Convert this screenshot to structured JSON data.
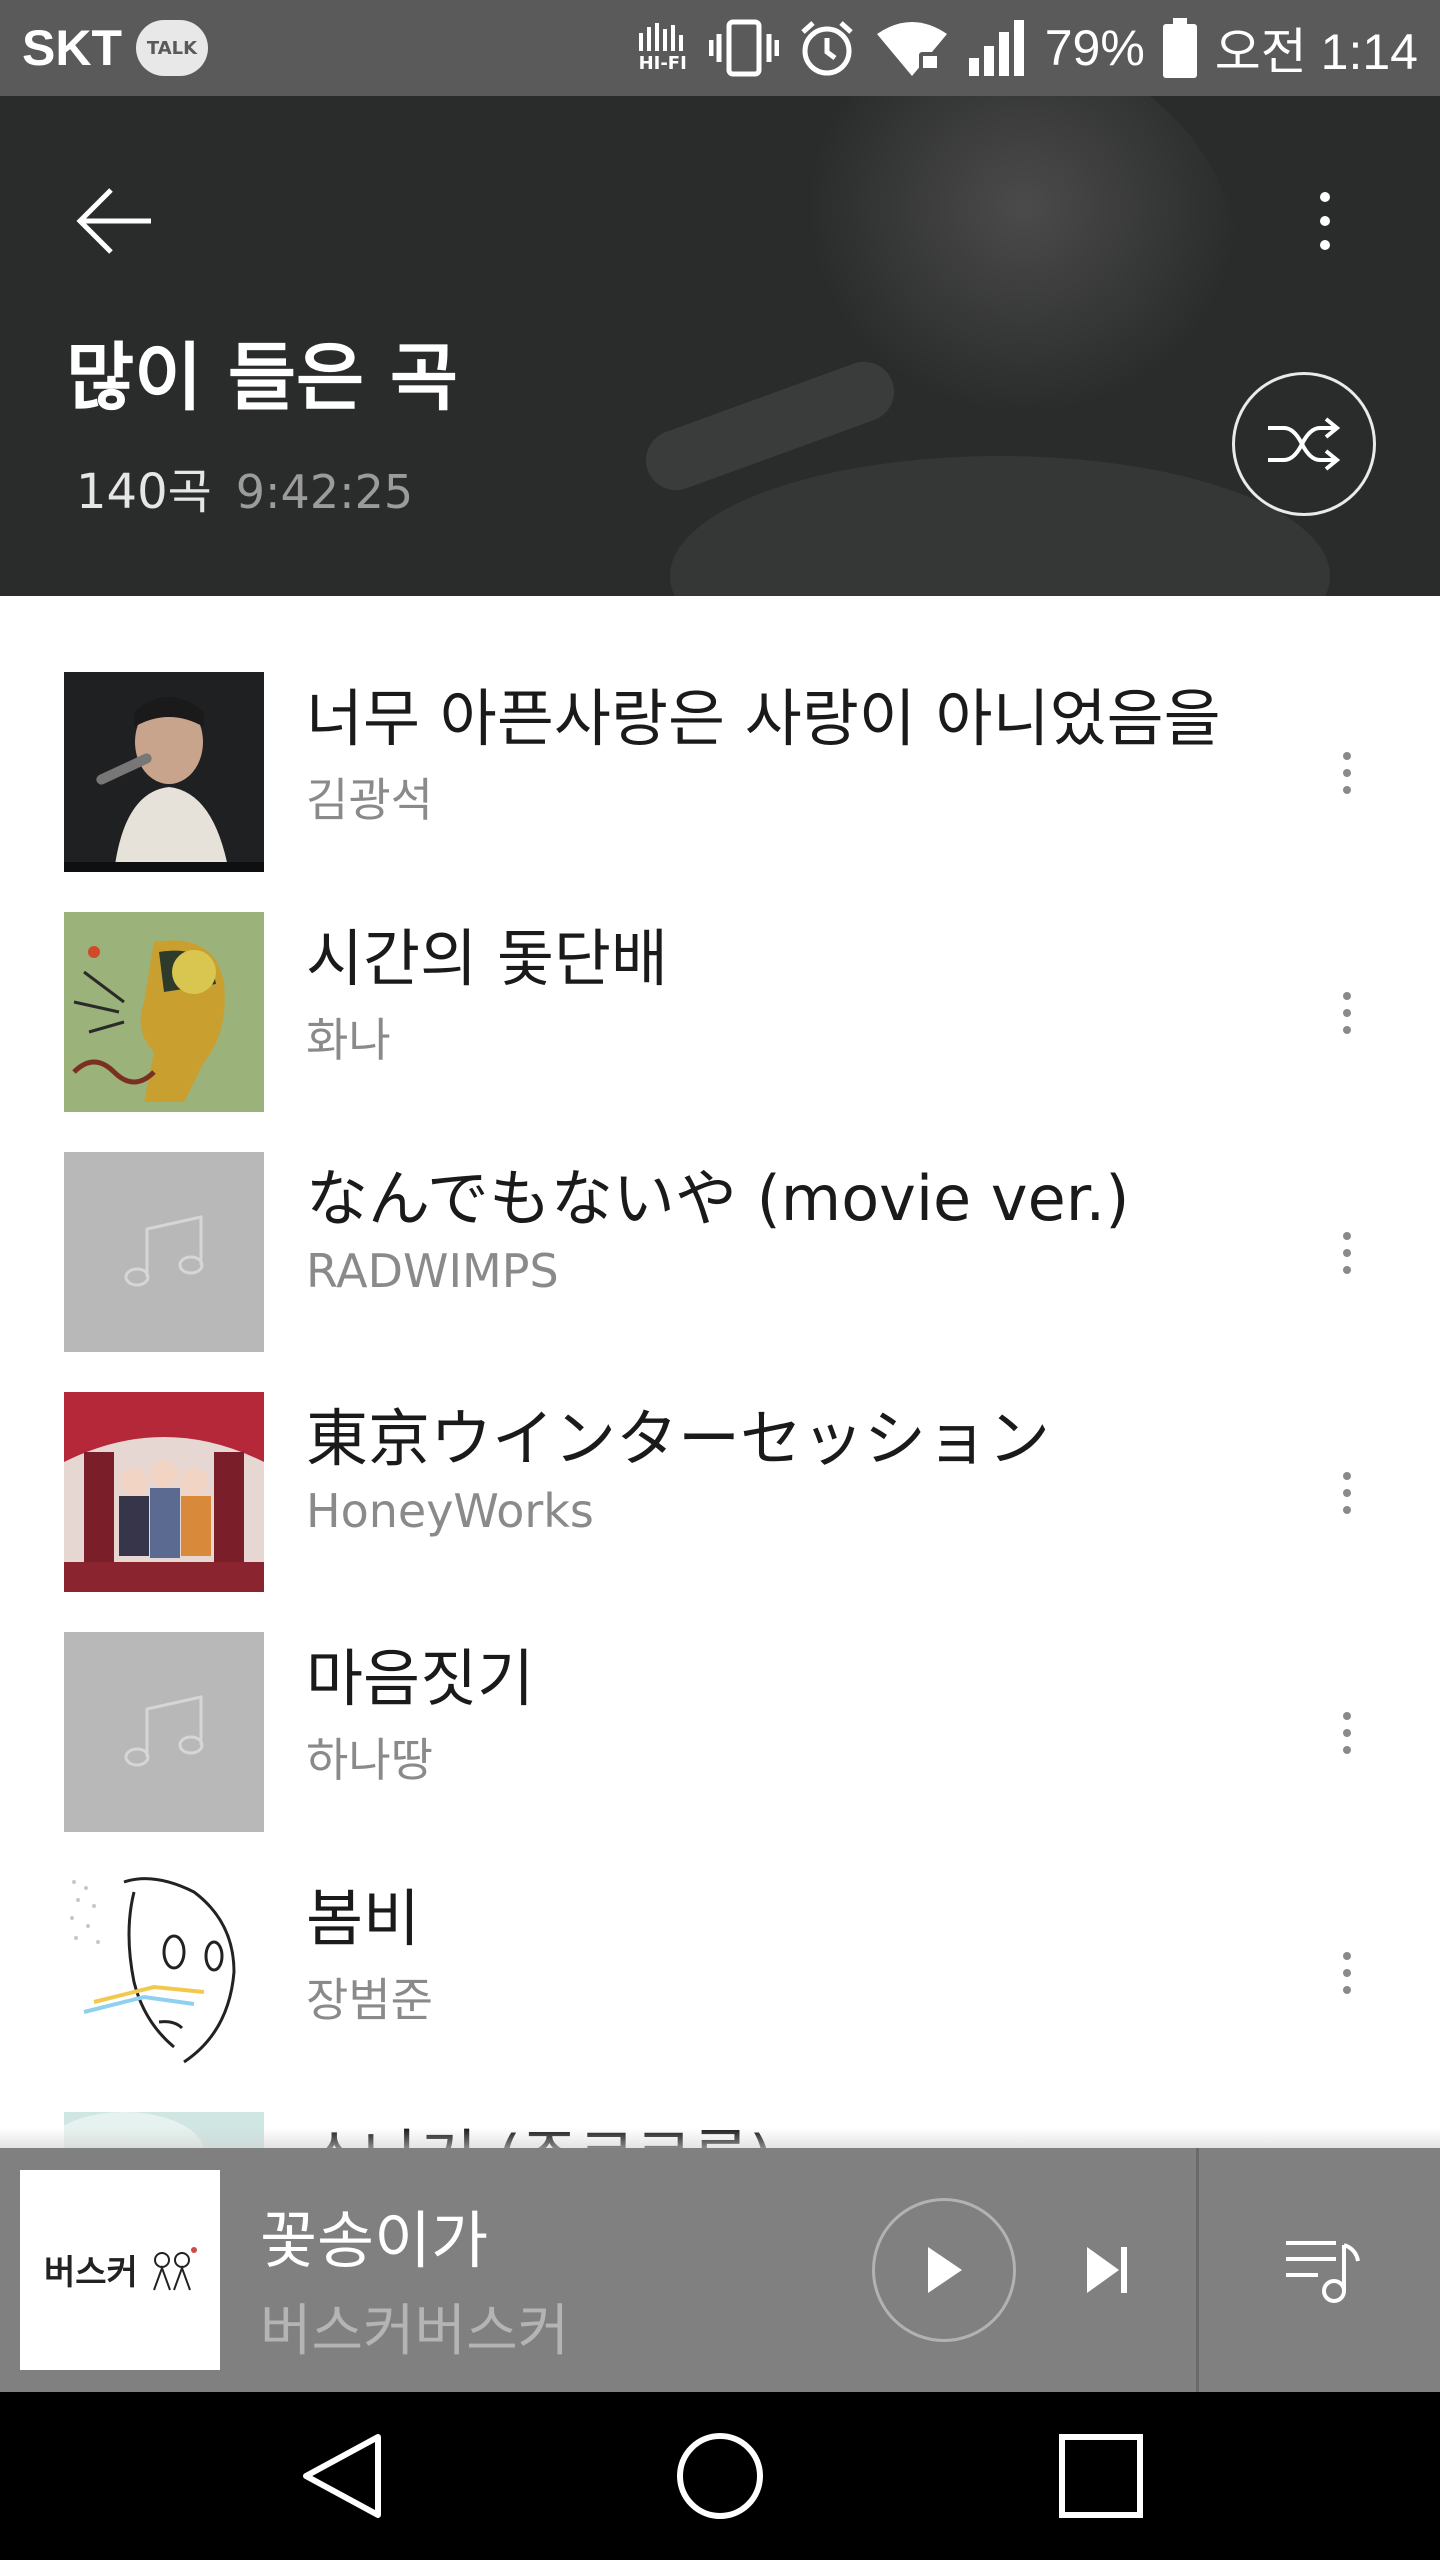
{
  "status_bar": {
    "carrier": "SKT",
    "talk_label": "TALK",
    "hifi_label": "HI-FI",
    "battery": "79%",
    "time": "오전 1:14"
  },
  "header": {
    "title": "많이 들은 곡",
    "song_count": "140곡",
    "total_duration": "9:42:25"
  },
  "songs": [
    {
      "title": "너무 아픈사랑은 사랑이 아니었음을",
      "artist": "김광석",
      "thumb": "photo-live"
    },
    {
      "title": "시간의 돛단배",
      "artist": "화나",
      "thumb": "brainstorming-ep"
    },
    {
      "title": "なんでもないや (movie ver.)",
      "artist": "RADWIMPS",
      "thumb": "placeholder-music-note"
    },
    {
      "title": "東京ウインターセッション",
      "artist": "HoneyWorks",
      "thumb": "group-illustration"
    },
    {
      "title": "마음짓기",
      "artist": "하나땅",
      "thumb": "placeholder-music-note"
    },
    {
      "title": "봄비",
      "artist": "장범준",
      "thumb": "manga-sketch"
    },
    {
      "title": "소나기 (주르르룩)",
      "artist": "",
      "thumb": "pastel-cover"
    }
  ],
  "mini_player": {
    "title": "꽃송이가",
    "artist": "버스커버스커",
    "cover_text": "버스커"
  },
  "colors": {
    "status_bar": "#5a5a5a",
    "header_bg": "#2a2b2b",
    "player_bg": "#808080",
    "nav_bg": "#000000"
  }
}
